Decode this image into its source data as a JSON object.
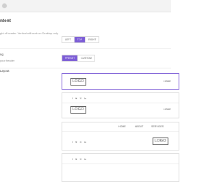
{
  "header": {
    "title": "ntent"
  },
  "rows": {
    "row1": {
      "desc": "ght of header. Vertical will work on Desktop only.",
      "options": [
        "LEFT",
        "TOP",
        "RIGHT"
      ],
      "selected": "TOP"
    },
    "row2": {
      "label": "ng",
      "desc": "your header",
      "options": [
        "PRESET",
        "CUSTOM"
      ],
      "selected": "PRESET"
    },
    "row3": {
      "label": "Layout"
    }
  },
  "layouts": {
    "logo_text": "LOGO",
    "home_text": "HOME",
    "social_icons": [
      "f",
      "♥",
      "X",
      "in"
    ],
    "nav_items": [
      "HOME",
      "ABOUT",
      "SERVICES"
    ]
  },
  "colors": {
    "accent": "#7b5bd6"
  }
}
